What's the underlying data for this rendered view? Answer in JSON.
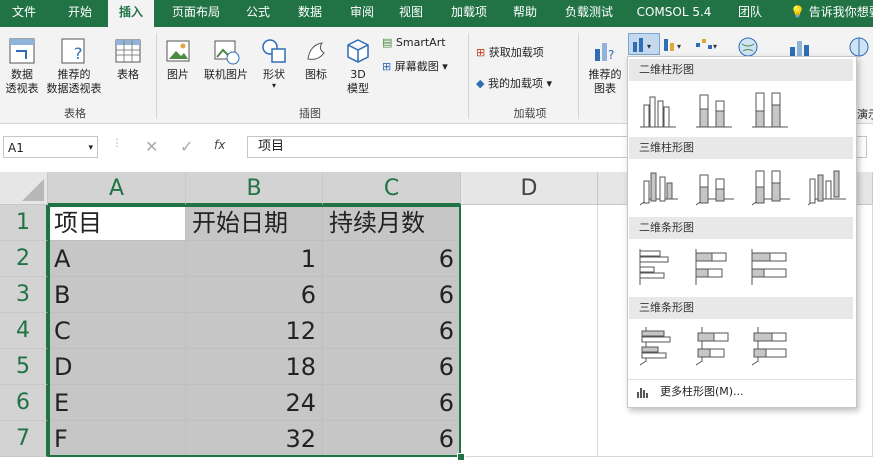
{
  "tabs": [
    "文件",
    "开始",
    "插入",
    "页面布局",
    "公式",
    "数据",
    "审阅",
    "视图",
    "加载项",
    "帮助",
    "负载测试",
    "COMSOL 5.4",
    "团队"
  ],
  "active_tab": "插入",
  "tell_me": "告诉我你想要",
  "ribbon": {
    "pivot_table": "数据\n透视表",
    "recommended_pivot": "推荐的\n数据透视表",
    "table": "表格",
    "tables_group": "表格",
    "picture": "图片",
    "online_picture": "联机图片",
    "shapes": "形状",
    "icons": "图标",
    "model3d": "3D\n模型",
    "smartart": "SmartArt",
    "screenshot": "屏幕截图",
    "illustrations_group": "插图",
    "get_addins": "获取加载项",
    "my_addins": "我的加载项",
    "addins_group": "加载项",
    "recommended_charts": "推荐的\n图表",
    "demo_partial": "演示"
  },
  "formula_bar": {
    "name_box": "A1",
    "fx": "fx",
    "content": "项目"
  },
  "columns": [
    "A",
    "B",
    "C",
    "D"
  ],
  "rows": [
    "1",
    "2",
    "3",
    "4",
    "5",
    "6",
    "7"
  ],
  "table": {
    "header": [
      "项目",
      "开始日期",
      "持续月数"
    ],
    "rows": [
      [
        "A",
        "1",
        "6"
      ],
      [
        "B",
        "6",
        "6"
      ],
      [
        "C",
        "12",
        "6"
      ],
      [
        "D",
        "18",
        "6"
      ],
      [
        "E",
        "24",
        "6"
      ],
      [
        "F",
        "32",
        "6"
      ]
    ]
  },
  "chart_menu": {
    "sections": [
      "二维柱形图",
      "三维柱形图",
      "二维条形图",
      "三维条形图"
    ],
    "more": "更多柱形图(M)..."
  },
  "colors": {
    "excel_green": "#217346",
    "selection_gray": "#c6c6c6"
  }
}
